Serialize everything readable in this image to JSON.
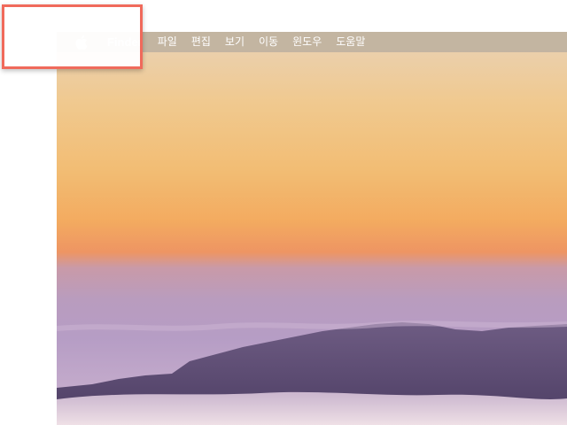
{
  "menubar": {
    "apple_icon": "apple-logo-icon",
    "app_name": "Finder",
    "items": [
      "파일",
      "편집",
      "보기",
      "이동",
      "윈도우",
      "도움말"
    ]
  },
  "highlight": {
    "color": "#f06a5b"
  }
}
